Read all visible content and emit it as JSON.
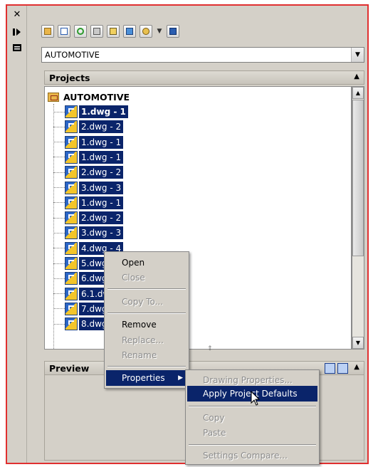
{
  "leftbar": {
    "close_icon": "✕",
    "pin_icon": "auto-hide-icon",
    "properties_icon": "properties-icon"
  },
  "toolbar": {
    "buttons": [
      "open-project-icon",
      "new-sheet-icon",
      "refresh-icon",
      "eTransmit-icon",
      "archive-icon",
      "publish-icon",
      "views-icon",
      "help-icon"
    ]
  },
  "project_combo": {
    "value": "AUTOMOTIVE"
  },
  "projects_panel": {
    "title": "Projects",
    "root": "AUTOMOTIVE",
    "items": [
      "1.dwg - 1",
      "2.dwg - 2",
      "1.dwg - 1",
      "1.dwg - 1",
      "2.dwg - 2",
      "3.dwg - 3",
      "1.dwg - 1",
      "2.dwg - 2",
      "3.dwg - 3",
      "4.dwg - 4",
      "5.dwg",
      "6.dwg",
      "6.1.dw",
      "7.dwg",
      "8.dwg"
    ]
  },
  "preview_panel": {
    "title": "Preview"
  },
  "context_menu": {
    "items": {
      "open": "Open",
      "close": "Close",
      "copy_to": "Copy To...",
      "remove": "Remove",
      "replace": "Replace...",
      "rename": "Rename",
      "properties": "Properties"
    }
  },
  "submenu": {
    "items": {
      "drawing_properties": "Drawing Properties...",
      "apply_project_defaults": "Apply Project Defaults",
      "copy": "Copy",
      "paste": "Paste",
      "settings_compare": "Settings Compare..."
    }
  },
  "colors": {
    "highlight": "#0a246a",
    "frame_border": "#e03030",
    "panel_bg": "#d4d0c8"
  }
}
